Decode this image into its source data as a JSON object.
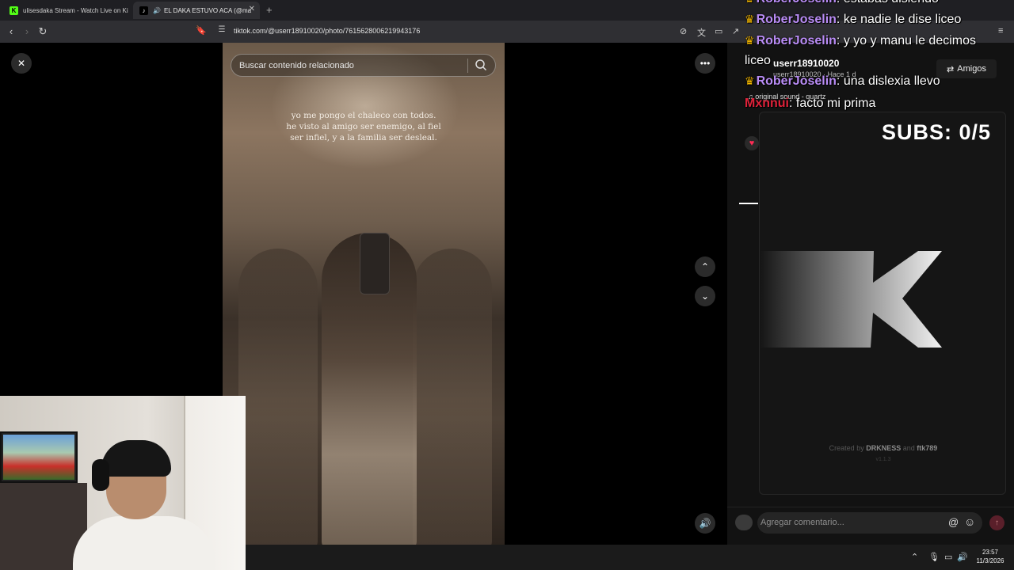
{
  "browser": {
    "tabs": [
      {
        "title": "ulisesdaka Stream - Watch Live on Ki",
        "favicon_color": "#53fc18"
      },
      {
        "title": "EL DAKA ESTUVO ACA (@ma",
        "favicon_color": "#ffffff"
      }
    ],
    "url": "tiktok.com/@userr18910020/photo/7615628006219943176"
  },
  "viewer": {
    "search_placeholder": "Buscar contenido relacionado",
    "caption_lines": [
      "yo me pongo el chaleco con todos.",
      "he visto al amigo ser enemigo, al fiel",
      "ser infiel, y a la familia ser desleal."
    ]
  },
  "post": {
    "username": "userr18910020",
    "meta": "userr18910020 · Hace 1 d",
    "sound": "original sound - quartz",
    "follow_label": "Amigos",
    "comment_placeholder": "Agregar comentario..."
  },
  "chat": [
    {
      "user": "RoberJoselin",
      "message": ": estabas disiendo",
      "color": "#b98cf5",
      "crown": true
    },
    {
      "user": "RoberJoselin",
      "message": ": ke nadie le dise liceo",
      "color": "#b98cf5",
      "crown": true
    },
    {
      "user": "RoberJoselin",
      "message": ": y yo y manu le decimos",
      "color": "#b98cf5",
      "crown": true
    },
    {
      "user": "",
      "message": "liceo",
      "color": "#ffffff",
      "crown": false
    },
    {
      "user": "RoberJoselin",
      "message": ": una dislexia llevo",
      "color": "#b98cf5",
      "crown": true
    },
    {
      "user": "Mxnnui",
      "message": ": facto mi prima",
      "color": "#e0223a",
      "crown": false
    }
  ],
  "subs_overlay": {
    "text": "SUBS: 0/5",
    "credit_prefix": "Created by",
    "credit_author1": "DRKNESS",
    "credit_and": "and",
    "credit_author2": "ftk789",
    "version": "v1.1.3"
  },
  "taskbar": {
    "time": "23:57",
    "date": "11/3/2026"
  }
}
